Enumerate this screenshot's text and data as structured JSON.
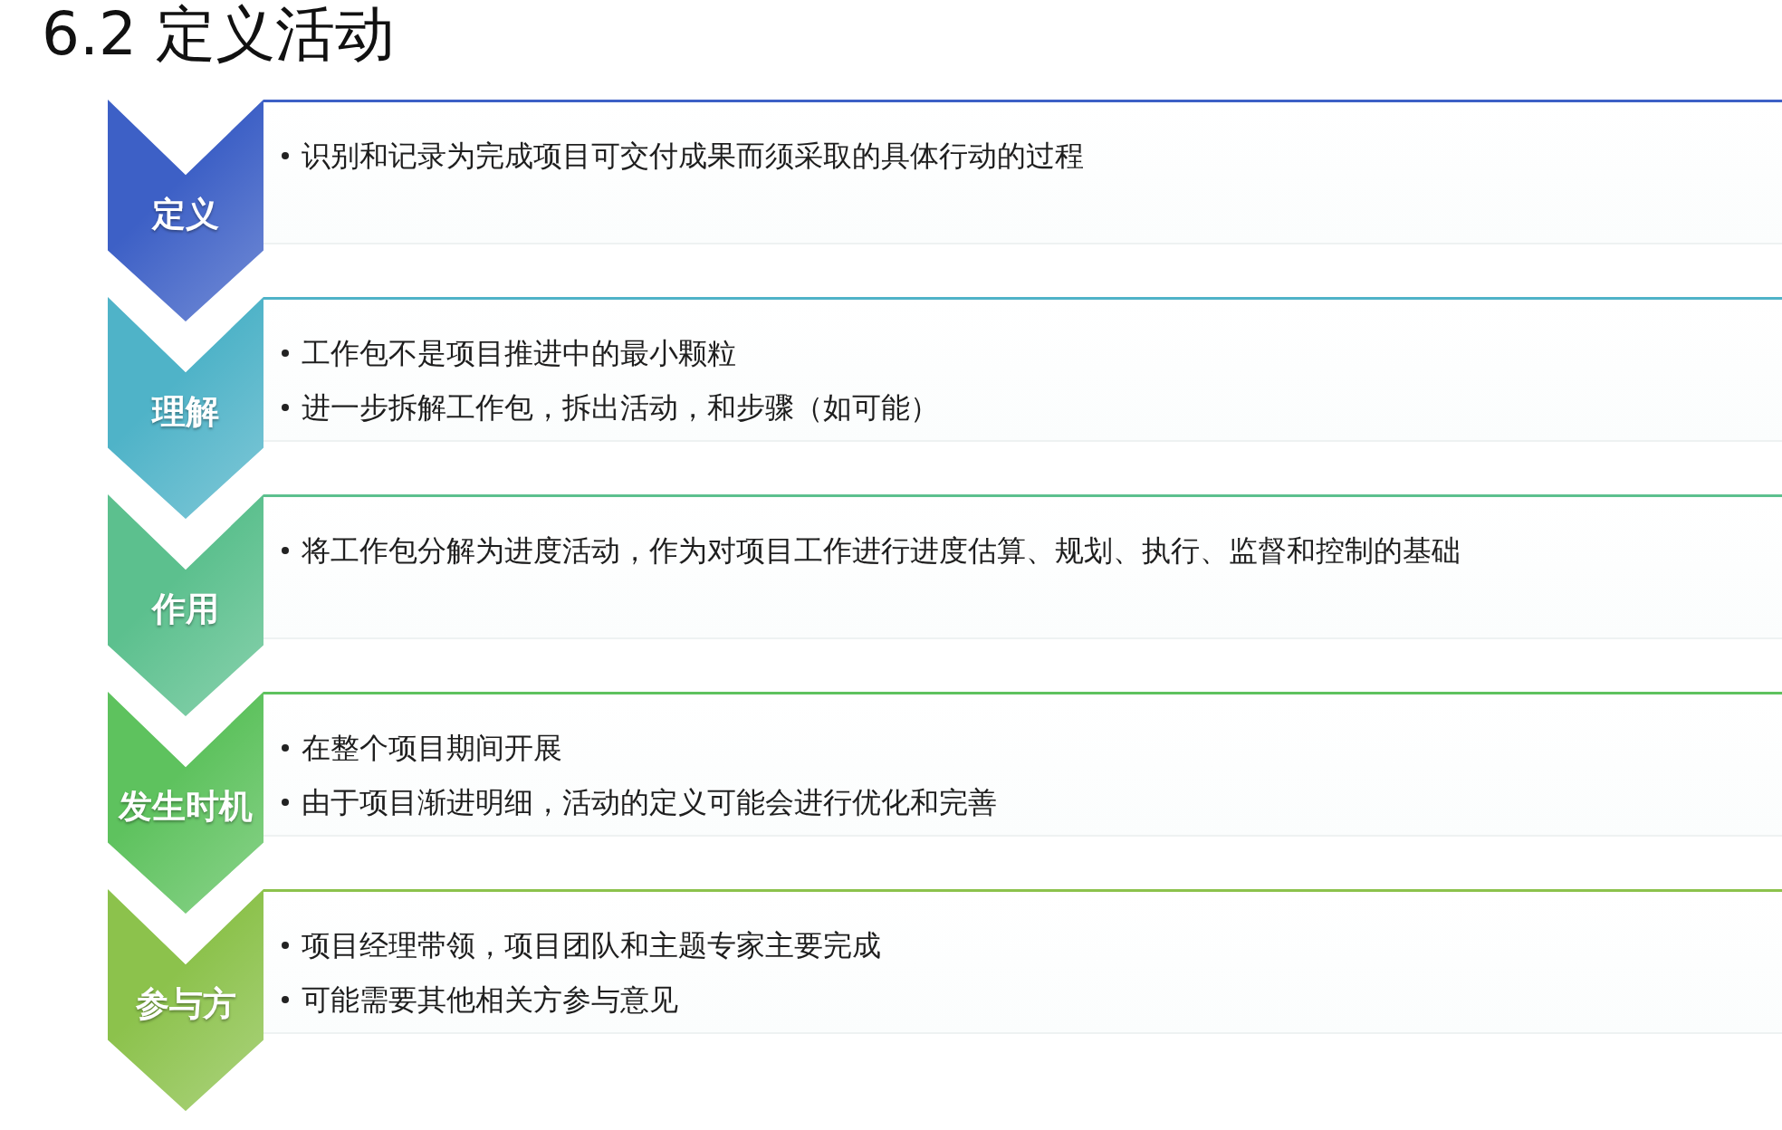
{
  "title": "6.2 定义活动",
  "stages": [
    {
      "label": "定义",
      "color": "#3d60c6",
      "points": [
        "识别和记录为完成项目可交付成果而须采取的具体行动的过程"
      ]
    },
    {
      "label": "理解",
      "color": "#4fb3c8",
      "points": [
        "工作包不是项目推进中的最小颗粒",
        "进一步拆解工作包，拆出活动，和步骤（如可能）"
      ]
    },
    {
      "label": "作用",
      "color": "#5cc08e",
      "points": [
        "将工作包分解为进度活动，作为对项目工作进行进度估算、规划、执行、监督和控制的基础"
      ]
    },
    {
      "label": "发生时机",
      "color": "#5ec25e",
      "points": [
        "在整个项目期间开展",
        "由于项目渐进明细，活动的定义可能会进行优化和完善"
      ]
    },
    {
      "label": "参与方",
      "color": "#8cc24c",
      "points": [
        "项目经理带领，项目团队和主题专家主要完成",
        "可能需要其他相关方参与意见"
      ]
    }
  ]
}
